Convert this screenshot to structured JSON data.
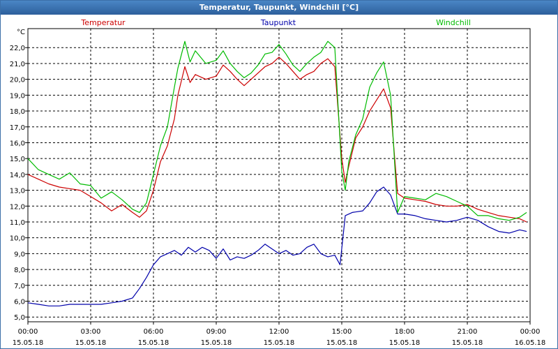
{
  "window": {
    "title": "Temperatur, Taupunkt, Windchill [°C]"
  },
  "chart_data": {
    "type": "line",
    "title": "Temperatur, Taupunkt, Windchill [°C]",
    "ylabel": "°C",
    "ylim": [
      4.7,
      23.2
    ],
    "xlim": [
      "15.05.18 00:00",
      "16.05.18 00:00"
    ],
    "grid": true,
    "y_ticks": [
      "5,0",
      "6,0",
      "7,0",
      "8,0",
      "9,0",
      "10,0",
      "11,0",
      "12,0",
      "13,0",
      "14,0",
      "15,0",
      "16,0",
      "17,0",
      "18,0",
      "19,0",
      "20,0",
      "21,0",
      "22,0"
    ],
    "x_ticks": [
      {
        "time": "00:00",
        "date": "15.05.18"
      },
      {
        "time": "03:00",
        "date": "15.05.18"
      },
      {
        "time": "06:00",
        "date": "15.05.18"
      },
      {
        "time": "09:00",
        "date": "15.05.18"
      },
      {
        "time": "12:00",
        "date": "15.05.18"
      },
      {
        "time": "15:00",
        "date": "15.05.18"
      },
      {
        "time": "18:00",
        "date": "15.05.18"
      },
      {
        "time": "21:00",
        "date": "15.05.18"
      },
      {
        "time": "00:00",
        "date": "16.05.18"
      }
    ],
    "series": [
      {
        "name": "Temperatur",
        "color": "#cc0000",
        "points": [
          [
            "00:00",
            14.0
          ],
          [
            "00:30",
            13.7
          ],
          [
            "01:00",
            13.4
          ],
          [
            "01:30",
            13.2
          ],
          [
            "02:00",
            13.1
          ],
          [
            "02:30",
            13.0
          ],
          [
            "03:00",
            12.6
          ],
          [
            "03:30",
            12.2
          ],
          [
            "04:00",
            11.7
          ],
          [
            "04:30",
            12.1
          ],
          [
            "05:00",
            11.6
          ],
          [
            "05:20",
            11.3
          ],
          [
            "05:40",
            11.7
          ],
          [
            "06:00",
            13.0
          ],
          [
            "06:20",
            14.8
          ],
          [
            "06:40",
            15.8
          ],
          [
            "07:00",
            17.5
          ],
          [
            "07:10",
            19.0
          ],
          [
            "07:30",
            20.8
          ],
          [
            "07:45",
            19.8
          ],
          [
            "08:00",
            20.3
          ],
          [
            "08:30",
            20.0
          ],
          [
            "09:00",
            20.2
          ],
          [
            "09:20",
            20.9
          ],
          [
            "09:40",
            20.5
          ],
          [
            "10:00",
            20.0
          ],
          [
            "10:20",
            19.6
          ],
          [
            "10:40",
            20.0
          ],
          [
            "11:00",
            20.4
          ],
          [
            "11:20",
            20.8
          ],
          [
            "11:40",
            21.0
          ],
          [
            "12:00",
            21.4
          ],
          [
            "12:20",
            21.0
          ],
          [
            "12:40",
            20.5
          ],
          [
            "13:00",
            20.0
          ],
          [
            "13:20",
            20.3
          ],
          [
            "13:40",
            20.5
          ],
          [
            "14:00",
            21.0
          ],
          [
            "14:20",
            21.3
          ],
          [
            "14:40",
            20.8
          ],
          [
            "15:00",
            15.0
          ],
          [
            "15:10",
            13.5
          ],
          [
            "15:20",
            14.5
          ],
          [
            "15:40",
            16.3
          ],
          [
            "16:00",
            17.0
          ],
          [
            "16:20",
            18.0
          ],
          [
            "16:40",
            18.7
          ],
          [
            "17:00",
            19.4
          ],
          [
            "17:20",
            18.2
          ],
          [
            "17:40",
            12.8
          ],
          [
            "18:00",
            12.5
          ],
          [
            "18:30",
            12.4
          ],
          [
            "19:00",
            12.3
          ],
          [
            "19:30",
            12.1
          ],
          [
            "20:00",
            12.0
          ],
          [
            "20:30",
            12.0
          ],
          [
            "21:00",
            12.1
          ],
          [
            "21:30",
            11.8
          ],
          [
            "22:00",
            11.6
          ],
          [
            "22:30",
            11.4
          ],
          [
            "23:00",
            11.3
          ],
          [
            "23:30",
            11.2
          ],
          [
            "23:50",
            11.0
          ]
        ]
      },
      {
        "name": "Taupunkt",
        "color": "#0000aa",
        "points": [
          [
            "00:00",
            5.9
          ],
          [
            "00:30",
            5.8
          ],
          [
            "01:00",
            5.7
          ],
          [
            "01:30",
            5.7
          ],
          [
            "02:00",
            5.8
          ],
          [
            "02:30",
            5.8
          ],
          [
            "03:00",
            5.8
          ],
          [
            "03:30",
            5.8
          ],
          [
            "04:00",
            5.9
          ],
          [
            "04:30",
            6.0
          ],
          [
            "05:00",
            6.2
          ],
          [
            "05:20",
            6.8
          ],
          [
            "05:40",
            7.5
          ],
          [
            "06:00",
            8.3
          ],
          [
            "06:20",
            8.8
          ],
          [
            "06:40",
            9.0
          ],
          [
            "07:00",
            9.2
          ],
          [
            "07:20",
            8.9
          ],
          [
            "07:40",
            9.4
          ],
          [
            "08:00",
            9.1
          ],
          [
            "08:20",
            9.4
          ],
          [
            "08:40",
            9.2
          ],
          [
            "09:00",
            8.7
          ],
          [
            "09:20",
            9.3
          ],
          [
            "09:40",
            8.6
          ],
          [
            "10:00",
            8.8
          ],
          [
            "10:20",
            8.7
          ],
          [
            "10:40",
            8.9
          ],
          [
            "11:00",
            9.2
          ],
          [
            "11:20",
            9.6
          ],
          [
            "11:40",
            9.3
          ],
          [
            "12:00",
            9.0
          ],
          [
            "12:20",
            9.2
          ],
          [
            "12:40",
            8.9
          ],
          [
            "13:00",
            9.0
          ],
          [
            "13:20",
            9.4
          ],
          [
            "13:40",
            9.6
          ],
          [
            "14:00",
            9.0
          ],
          [
            "14:20",
            8.8
          ],
          [
            "14:40",
            8.9
          ],
          [
            "14:55",
            8.3
          ],
          [
            "15:10",
            11.4
          ],
          [
            "15:30",
            11.6
          ],
          [
            "16:00",
            11.7
          ],
          [
            "16:20",
            12.2
          ],
          [
            "16:40",
            12.9
          ],
          [
            "17:00",
            13.2
          ],
          [
            "17:20",
            12.7
          ],
          [
            "17:40",
            11.5
          ],
          [
            "18:00",
            11.5
          ],
          [
            "18:30",
            11.4
          ],
          [
            "19:00",
            11.2
          ],
          [
            "19:30",
            11.1
          ],
          [
            "20:00",
            11.0
          ],
          [
            "20:30",
            11.1
          ],
          [
            "21:00",
            11.3
          ],
          [
            "21:30",
            11.1
          ],
          [
            "22:00",
            10.7
          ],
          [
            "22:30",
            10.4
          ],
          [
            "23:00",
            10.3
          ],
          [
            "23:30",
            10.5
          ],
          [
            "23:50",
            10.4
          ]
        ]
      },
      {
        "name": "Windchill",
        "color": "#00bb00",
        "points": [
          [
            "00:00",
            15.0
          ],
          [
            "00:30",
            14.3
          ],
          [
            "01:00",
            14.0
          ],
          [
            "01:30",
            13.7
          ],
          [
            "02:00",
            14.1
          ],
          [
            "02:30",
            13.4
          ],
          [
            "03:00",
            13.3
          ],
          [
            "03:30",
            12.5
          ],
          [
            "04:00",
            12.9
          ],
          [
            "04:30",
            12.4
          ],
          [
            "05:00",
            11.8
          ],
          [
            "05:20",
            11.6
          ],
          [
            "05:40",
            12.2
          ],
          [
            "06:00",
            14.0
          ],
          [
            "06:20",
            15.8
          ],
          [
            "06:40",
            17.0
          ],
          [
            "07:00",
            19.5
          ],
          [
            "07:10",
            20.7
          ],
          [
            "07:30",
            22.4
          ],
          [
            "07:45",
            21.1
          ],
          [
            "08:00",
            21.8
          ],
          [
            "08:30",
            21.0
          ],
          [
            "09:00",
            21.2
          ],
          [
            "09:20",
            21.8
          ],
          [
            "09:40",
            21.0
          ],
          [
            "10:00",
            20.5
          ],
          [
            "10:20",
            20.1
          ],
          [
            "10:40",
            20.4
          ],
          [
            "11:00",
            20.9
          ],
          [
            "11:20",
            21.6
          ],
          [
            "11:40",
            21.7
          ],
          [
            "12:00",
            22.2
          ],
          [
            "12:20",
            21.6
          ],
          [
            "12:40",
            20.9
          ],
          [
            "13:00",
            20.5
          ],
          [
            "13:20",
            21.0
          ],
          [
            "13:40",
            21.4
          ],
          [
            "14:00",
            21.7
          ],
          [
            "14:20",
            22.4
          ],
          [
            "14:40",
            22.0
          ],
          [
            "15:00",
            14.2
          ],
          [
            "15:10",
            13.0
          ],
          [
            "15:20",
            14.8
          ],
          [
            "15:40",
            16.5
          ],
          [
            "16:00",
            17.5
          ],
          [
            "16:20",
            19.5
          ],
          [
            "16:40",
            20.4
          ],
          [
            "17:00",
            21.1
          ],
          [
            "17:20",
            19.0
          ],
          [
            "17:40",
            11.6
          ],
          [
            "18:00",
            12.6
          ],
          [
            "18:30",
            12.5
          ],
          [
            "19:00",
            12.4
          ],
          [
            "19:30",
            12.8
          ],
          [
            "20:00",
            12.6
          ],
          [
            "20:30",
            12.3
          ],
          [
            "21:00",
            12.0
          ],
          [
            "21:30",
            11.4
          ],
          [
            "22:00",
            11.4
          ],
          [
            "22:30",
            11.2
          ],
          [
            "23:00",
            11.1
          ],
          [
            "23:30",
            11.3
          ],
          [
            "23:50",
            11.6
          ]
        ]
      }
    ]
  }
}
